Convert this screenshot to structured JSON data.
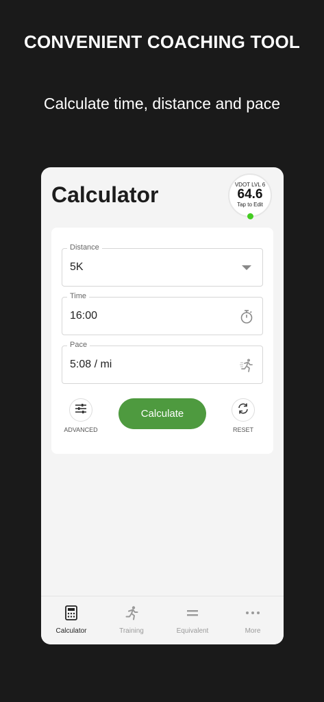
{
  "promo": {
    "headline": "CONVENIENT COACHING TOOL",
    "subheadline": "Calculate time, distance and pace"
  },
  "app": {
    "title": "Calculator",
    "vdot": {
      "level": "VDOT LVL 6",
      "value": "64.6",
      "edit_hint": "Tap to Edit",
      "status_color": "#44cc22"
    }
  },
  "form": {
    "distance": {
      "label": "Distance",
      "value": "5K",
      "icon": "chevron-down-icon"
    },
    "time": {
      "label": "Time",
      "value": "16:00",
      "icon": "stopwatch-icon"
    },
    "pace": {
      "label": "Pace",
      "value": "5:08 / mi",
      "icon": "runner-icon"
    }
  },
  "actions": {
    "advanced_label": "ADVANCED",
    "calculate_label": "Calculate",
    "reset_label": "RESET",
    "accent_color": "#4e9a3f"
  },
  "tabs": [
    {
      "label": "Calculator",
      "icon": "calculator-icon",
      "active": true
    },
    {
      "label": "Training",
      "icon": "runner-icon",
      "active": false
    },
    {
      "label": "Equivalent",
      "icon": "equals-icon",
      "active": false
    },
    {
      "label": "More",
      "icon": "more-icon",
      "active": false
    }
  ]
}
